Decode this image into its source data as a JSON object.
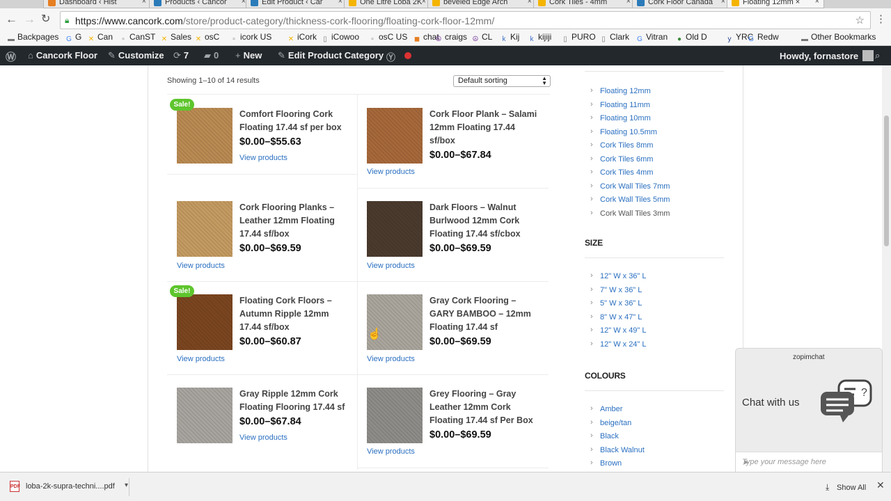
{
  "browser": {
    "tabs": [
      {
        "label": "Dashboard ‹ Hist",
        "fav_color": "#e67e22"
      },
      {
        "label": "Products ‹ Cancor",
        "fav_color": "#2b7bb9"
      },
      {
        "label": "Edit Product ‹ Car",
        "fav_color": "#2b7bb9"
      },
      {
        "label": "One Litre Loba 2K",
        "fav_color": "#f4b400"
      },
      {
        "label": "beveled Edge Arch",
        "fav_color": "#f4b400"
      },
      {
        "label": "Cork Tiles - 4mm",
        "fav_color": "#f4b400"
      },
      {
        "label": "Cork Floor Canada",
        "fav_color": "#2b7bb9"
      },
      {
        "label": "Floating 12mm ×",
        "fav_color": "#f4b400"
      }
    ],
    "url_host": "https://www.cancork.com",
    "url_path": "/store/product-category/thickness-cork-flooring/floating-cork-floor-12mm/",
    "bookmarks": [
      {
        "label": "Backpages",
        "icon": "folder-icon"
      },
      {
        "label": "G",
        "icon": "google-icon"
      },
      {
        "label": "Can",
        "icon": "cancork-icon"
      },
      {
        "label": "CanST",
        "icon": "page-icon"
      },
      {
        "label": "Sales",
        "icon": "cancork-icon"
      },
      {
        "label": "osC",
        "icon": "cancork-icon"
      },
      {
        "label": "icork US",
        "icon": "page-icon"
      },
      {
        "label": "iCork",
        "icon": "cancork-icon"
      },
      {
        "label": "iCowoo",
        "icon": "doc-icon"
      },
      {
        "label": "osC US",
        "icon": "page-icon"
      },
      {
        "label": "chat",
        "icon": "chat-icon"
      },
      {
        "label": "craigs",
        "icon": "peace-icon"
      },
      {
        "label": "CL",
        "icon": "peace-icon"
      },
      {
        "label": "Kij",
        "icon": "kijiji-icon"
      },
      {
        "label": "kijiji",
        "icon": "kijiji-icon"
      },
      {
        "label": "PURO",
        "icon": "doc-icon"
      },
      {
        "label": "Clark",
        "icon": "doc-icon"
      },
      {
        "label": "Vitran",
        "icon": "google-icon"
      },
      {
        "label": "Old D",
        "icon": "globe-icon"
      },
      {
        "label": "YRC",
        "icon": "yrc-icon"
      },
      {
        "label": "Redw",
        "icon": "google-icon"
      },
      {
        "label": "Other Bookmarks",
        "icon": "folder-icon"
      }
    ]
  },
  "wpbar": {
    "site": "Cancork Floor",
    "customize": "Customize",
    "updates": "7",
    "comments": "0",
    "new": "New",
    "edit": "Edit Product Category",
    "howdy": "Howdy, fornastore"
  },
  "shop": {
    "result_count": "Showing 1–10 of 14 results",
    "sorting": "Default sorting",
    "sale_badge": "Sale!",
    "view_label": "View products",
    "products": [
      {
        "title": "Comfort Flooring Cork Floating 17.44 sf per box",
        "price": "$0.00–$55.63",
        "sale": true,
        "color": "#b98a52"
      },
      {
        "title": "Cork Floor Plank – Salami 12mm Floating 17.44 sf/box",
        "price": "$0.00–$67.84",
        "sale": false,
        "color": "#a6683a"
      },
      {
        "title": "Cork Flooring Planks – Leather 12mm Floating 17.44 sf/box",
        "price": "$0.00–$69.59",
        "sale": false,
        "color": "#c39a61"
      },
      {
        "title": "Dark Floors – Walnut Burlwood 12mm Cork Floating 17.44 sf/cbox",
        "price": "$0.00–$69.59",
        "sale": false,
        "color": "#4a3a2e"
      },
      {
        "title": "Floating Cork Floors – Autumn Ripple 12mm 17.44 sf/box",
        "price": "$0.00–$60.87",
        "sale": true,
        "color": "#7a4520"
      },
      {
        "title": "Gray Cork Flooring – GARY BAMBOO – 12mm Floating 17.44 sf",
        "price": "$0.00–$69.59",
        "sale": false,
        "color": "#a9a59c"
      },
      {
        "title": "Gray Ripple 12mm Cork Floating Flooring 17.44 sf",
        "price": "$0.00–$67.84",
        "sale": false,
        "color": "#a7a39e"
      },
      {
        "title": "Grey Flooring – Gray Leather 12mm Cork Floating 17.44 sf Per Box",
        "price": "$0.00–$69.59",
        "sale": false,
        "color": "#8e8c88"
      }
    ]
  },
  "sidebar": {
    "thickness": [
      "Floating 12mm",
      "Floating 11mm",
      "Floating 10mm",
      "Floating 10.5mm",
      "Cork Tiles 8mm",
      "Cork Tiles 6mm",
      "Cork Tiles 4mm",
      "Cork Wall Tiles 7mm",
      "Cork Wall Tiles 5mm",
      "Cork Wall Tiles 3mm"
    ],
    "size_title": "SIZE",
    "sizes": [
      "12\" W x 36\" L",
      "7\" W x 36\" L",
      "5\" W x 36\" L",
      "8\" W x 47\" L",
      "12\" W x 49\" L",
      "12\" W x 24\" L"
    ],
    "colours_title": "COLOURS",
    "colours": [
      "Amber",
      "beige/tan",
      "Black",
      "Black Walnut",
      "Brown"
    ]
  },
  "chat": {
    "brand": "zopimchat",
    "headline": "Chat with us",
    "placeholder": "Type your message here"
  },
  "downloads": {
    "file": "loba-2k-supra-techni....pdf",
    "show_all": "Show All"
  }
}
